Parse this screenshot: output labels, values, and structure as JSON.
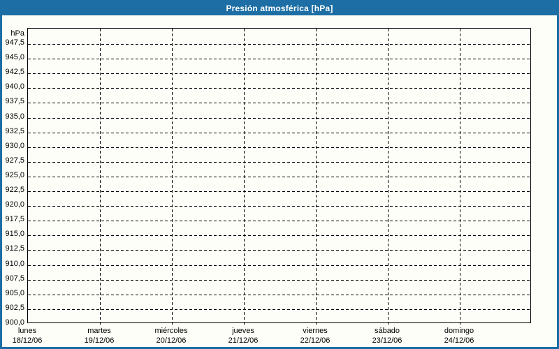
{
  "title": "Presión atmosférica [hPa]",
  "colors": {
    "accent": "#1C6EA4",
    "title_text": "#FFFFFF",
    "plot_line": "#000000",
    "background": "#FDFEF8"
  },
  "y_axis": {
    "unit_label": "hPa",
    "ticks": [
      "947,5",
      "945,0",
      "942,5",
      "940,0",
      "937,5",
      "935,0",
      "932,5",
      "930,0",
      "927,5",
      "925,0",
      "922,5",
      "920,0",
      "917,5",
      "915,0",
      "912,5",
      "910,0",
      "907,5",
      "905,0",
      "902,5",
      "900,0"
    ]
  },
  "x_axis": {
    "days": [
      {
        "name": "lunes",
        "date": "18/12/06"
      },
      {
        "name": "martes",
        "date": "19/12/06"
      },
      {
        "name": "miércoles",
        "date": "20/12/06"
      },
      {
        "name": "jueves",
        "date": "21/12/06"
      },
      {
        "name": "viernes",
        "date": "22/12/06"
      },
      {
        "name": "sábado",
        "date": "23/12/06"
      },
      {
        "name": "domingo",
        "date": "24/12/06"
      }
    ]
  },
  "chart_data": {
    "type": "line",
    "title": "Presión atmosférica [hPa]",
    "xlabel": "",
    "ylabel": "hPa",
    "ylim": [
      900.0,
      947.5
    ],
    "y_tick_step": 2.5,
    "categories": [
      "lunes 18/12/06",
      "martes 19/12/06",
      "miércoles 20/12/06",
      "jueves 21/12/06",
      "viernes 22/12/06",
      "sábado 23/12/06",
      "domingo 24/12/06"
    ],
    "series": [],
    "grid": "dashed-horizontal-and-vertical",
    "legend_position": "none",
    "note_no_data_plotted": true
  }
}
